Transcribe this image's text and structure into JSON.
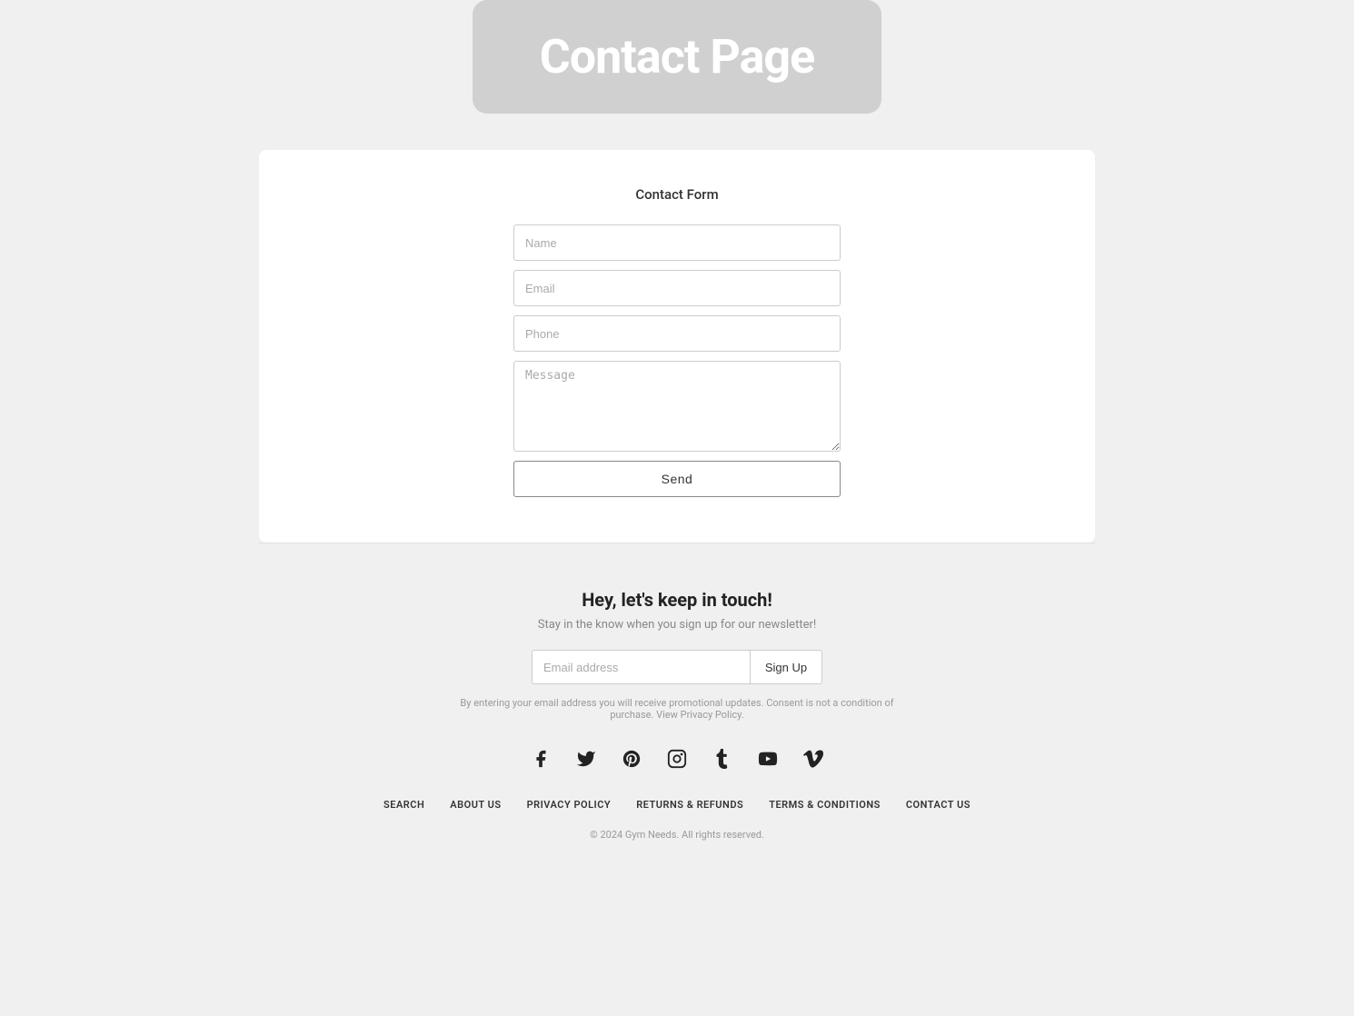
{
  "hero": {
    "title": "Contact Page"
  },
  "form": {
    "section_title": "Contact Form",
    "name_placeholder": "Name",
    "email_placeholder": "Email",
    "phone_placeholder": "Phone",
    "message_placeholder": "Message",
    "send_label": "Send"
  },
  "newsletter": {
    "title": "Hey, let's keep in touch!",
    "subtitle": "Stay in the know when you sign up for our newsletter!",
    "email_placeholder": "Email address",
    "signup_label": "Sign Up",
    "privacy_note": "By entering your email address you will receive promotional updates. Consent is not a condition of purchase. View Privacy Policy."
  },
  "social": [
    {
      "name": "facebook-icon",
      "symbol": "facebook"
    },
    {
      "name": "twitter-icon",
      "symbol": "twitter"
    },
    {
      "name": "pinterest-icon",
      "symbol": "pinterest"
    },
    {
      "name": "instagram-icon",
      "symbol": "instagram"
    },
    {
      "name": "tumblr-icon",
      "symbol": "tumblr"
    },
    {
      "name": "youtube-icon",
      "symbol": "youtube"
    },
    {
      "name": "vimeo-icon",
      "symbol": "vimeo"
    }
  ],
  "footer_nav": [
    {
      "label": "SEARCH",
      "name": "search-link"
    },
    {
      "label": "ABOUT US",
      "name": "about-us-link"
    },
    {
      "label": "PRIVACY POLICY",
      "name": "privacy-policy-link"
    },
    {
      "label": "RETURNS & REFUNDS",
      "name": "returns-refunds-link"
    },
    {
      "label": "TERMS & CONDITIONS",
      "name": "terms-conditions-link"
    },
    {
      "label": "CONTACT US",
      "name": "contact-us-link"
    }
  ],
  "copyright": "© 2024 Gym Needs. All rights reserved."
}
